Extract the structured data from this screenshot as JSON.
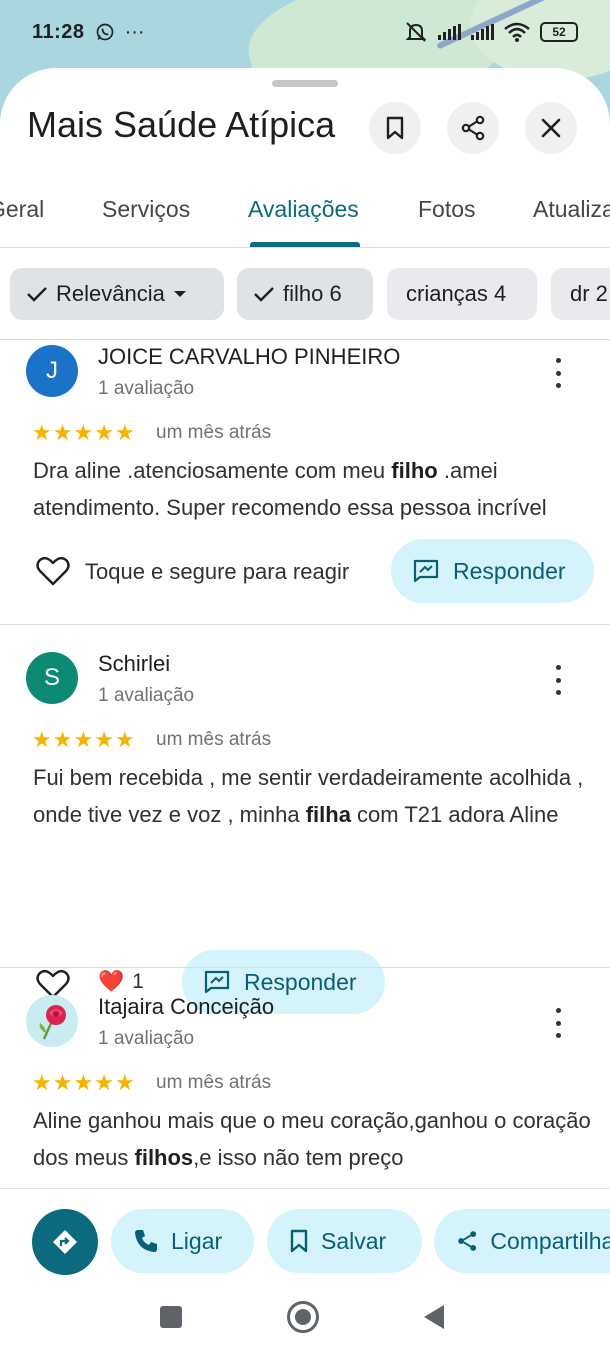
{
  "status_bar": {
    "time": "11:28",
    "more_glyph": "···",
    "battery": "52",
    "icons": [
      "whatsapp-icon",
      "mute-icon",
      "signal-icon",
      "signal-icon",
      "wifi-icon",
      "battery-icon"
    ]
  },
  "place": {
    "name": "Mais Saúde Atípica"
  },
  "tabs": [
    {
      "label": "Geral"
    },
    {
      "label": "Serviços"
    },
    {
      "label": "Avaliações",
      "active": true
    },
    {
      "label": "Fotos"
    },
    {
      "label": "Atualizações"
    }
  ],
  "chips": [
    {
      "label": "Relevância"
    },
    {
      "label": "filho 6"
    },
    {
      "label": "crianças 4"
    },
    {
      "label": "dr 2"
    }
  ],
  "reviews": [
    {
      "avatar_letter": "J",
      "avatar_color": "#1a73c9",
      "author": "JOICE CARVALHO PINHEIRO",
      "count": "1 avaliação",
      "rating": 5,
      "time": "um mês atrás",
      "text_parts": [
        "Dra aline .atenciosamente com meu ",
        "filho",
        " .amei atendimento. Super recomendo essa pessoa incrível"
      ],
      "react_prompt": "Toque e segure para reagir",
      "reply_label": "Responder"
    },
    {
      "avatar_letter": "S",
      "avatar_color": "#0d8a73",
      "author": "Schirlei",
      "count": "1 avaliação",
      "rating": 5,
      "time": "um mês atrás",
      "text_parts": [
        "Fui bem recebida , me sentir verdadeiramente acolhida , onde tive vez e voz , minha ",
        "filha",
        " com T21 adora Aline"
      ],
      "reaction_emoji": "❤️",
      "reaction_count": "1",
      "reply_label": "Responder"
    },
    {
      "avatar_icon": "rose-avatar-icon",
      "author": "Itajaira Conceição",
      "count": "1 avaliação",
      "rating": 5,
      "time": "um mês atrás",
      "text_parts": [
        "Aline ganhou mais que o meu coração,ganhou o coração dos meus ",
        "filhos",
        ",e isso não tem preço"
      ]
    }
  ],
  "actions": {
    "call": "Ligar",
    "save": "Salvar",
    "share": "Compartilhar"
  },
  "colors": {
    "accent": "#0b6a7e",
    "action_bg": "#d4f3fb",
    "star": "#f5b400"
  }
}
